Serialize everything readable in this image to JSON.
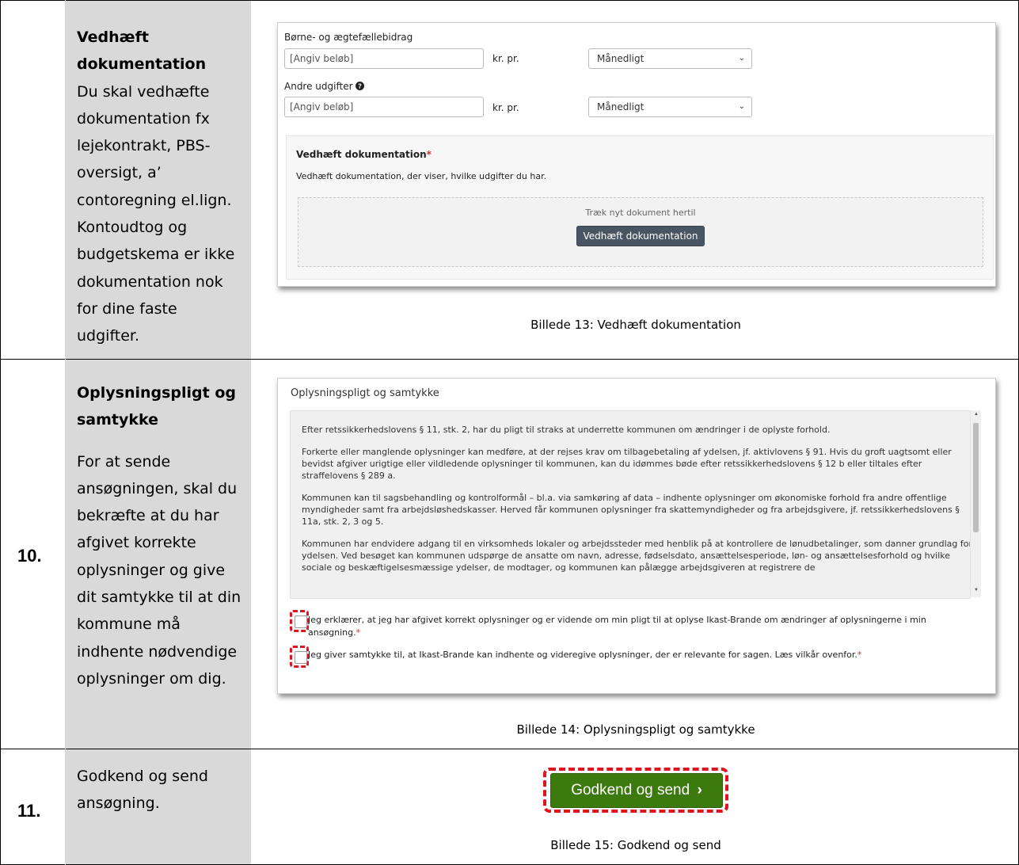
{
  "rows": [
    {
      "number": "",
      "title": "Vedhæft dokumentation",
      "body": "Du skal vedhæfte dokumentation fx lejekontrakt, PBS-oversigt, a’ contoregning el.lign. Kontoudtog og budgetskema er ikke dokumentation nok for dine faste udgifter."
    },
    {
      "number": "10.",
      "title": "Oplysningspligt og samtykke",
      "body": "For at sende ansøgningen, skal du bekræfte at du har afgivet korrekte oplysninger og give dit samtykke til at din kommune må indhente nødvendige oplysninger om dig."
    },
    {
      "number": "11.",
      "title": "",
      "body": "Godkend og send ansøgning."
    }
  ],
  "shot13": {
    "field1_label": "Børne- og ægtefællebidrag",
    "field1_placeholder": "[Angiv beløb]",
    "field1_unit": "kr. pr.",
    "field1_select": "Månedligt",
    "field2_label": "Andre udgifter",
    "field2_placeholder": "[Angiv beløb]",
    "field2_unit": "kr. pr.",
    "field2_select": "Månedligt",
    "panel_title": "Vedhæft dokumentation",
    "panel_required": "*",
    "panel_desc": "Vedhæft dokumentation, der viser, hvilke udgifter du har.",
    "drop_text": "Træk nyt dokument hertil",
    "attach_button": "Vedhæft dokumentation",
    "caption": "Billede 13: Vedhæft dokumentation"
  },
  "shot14": {
    "header": "Oplysningspligt og samtykke",
    "paragraphs": [
      "Efter retssikkerhedslovens § 11, stk. 2, har du pligt til straks at underrette kommunen om ændringer i de oplyste forhold.",
      "Forkerte eller manglende oplysninger kan medføre, at der rejses krav om tilbagebetaling af ydelsen, jf. aktivlovens § 91. Hvis du groft uagtsomt eller bevidst afgiver urigtige eller vildledende oplysninger til kommunen, kan du idømmes bøde efter retssikkerhedslovens § 12 b eller tiltales efter straffelovens § 289 a.",
      "Kommunen kan til sagsbehandling og kontrolformål – bl.a. via samkøring af data – indhente oplysninger om økonomiske forhold fra andre offentlige myndigheder samt fra arbejdsløshedskasser. Herved får kommunen oplysninger fra skattemyndigheder og fra arbejdsgivere, jf. retssikkerhedslovens § 11a, stk. 2, 3 og 5.",
      "Kommunen har endvidere adgang til en virksomheds lokaler og arbejdssteder med henblik på at kontrollere de lønudbetalinger, som danner grundlag for ydelsen. Ved besøget kan kommunen udspørge de ansatte om navn, adresse, fødselsdato, ansættelsesperiode, løn- og ansættelsesforhold og hvilke sociale og beskæftigelsesmæssige ydelser, de modtager, og kommunen kan pålægge arbejdsgiveren at registrere de"
    ],
    "check1": "Jeg erklærer, at jeg har afgivet korrekt oplysninger og er vidende om min pligt til at oplyse Ikast-Brande om ændringer af oplysningerne i min ansøgning.",
    "check2": "Jeg giver samtykke til, at Ikast-Brande kan indhente og videregive oplysninger, der er relevante for sagen. Læs vilkår ovenfor.",
    "required": "*",
    "caption": "Billede 14: Oplysningspligt og samtykke"
  },
  "shot15": {
    "button": "Godkend og send",
    "button_arrow": "›",
    "caption": "Billede 15: Godkend og send"
  }
}
